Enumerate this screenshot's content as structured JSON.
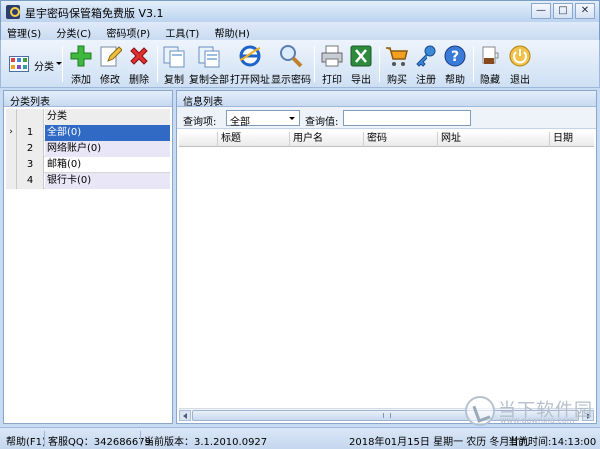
{
  "window": {
    "title": "星宇密码保管箱免费版 V3.1",
    "minimize": "—",
    "maximize": "□",
    "close": "✕"
  },
  "menu": [
    "管理(S)",
    "分类(C)",
    "密码项(P)",
    "工具(T)",
    "帮助(H)"
  ],
  "toolbar": {
    "category": "分类",
    "buttons": {
      "add": "添加",
      "edit": "修改",
      "delete": "删除",
      "copy": "复制",
      "copy_all": "复制全部",
      "open_url": "打开网址",
      "show_password": "显示密码",
      "print": "打印",
      "export": "导出",
      "buy": "购买",
      "register": "注册",
      "help": "帮助",
      "hide": "隐藏",
      "exit": "退出"
    }
  },
  "left_panel": {
    "title": "分类列表",
    "column_header": "分类",
    "rows": [
      {
        "num": "1",
        "name": "全部(0)",
        "indicator": "›"
      },
      {
        "num": "2",
        "name": "网络账户(0)",
        "indicator": ""
      },
      {
        "num": "3",
        "name": "邮箱(0)",
        "indicator": ""
      },
      {
        "num": "4",
        "name": "银行卡(0)",
        "indicator": ""
      }
    ]
  },
  "right_panel": {
    "title": "信息列表",
    "query_field_label": "查询项:",
    "query_field_value": "全部",
    "query_value_label": "查询值:",
    "query_value": "",
    "columns": [
      "标题",
      "用户名",
      "密码",
      "网址",
      "日期"
    ]
  },
  "status": {
    "help": "帮助(F1)",
    "qq": "客服QQ：342686679",
    "version": "当前版本：3.1.2010.0927",
    "date": "2018年01月15日 星期一 农历 冬月廿九",
    "time": "当前时间:14:13:00"
  },
  "watermark": {
    "text": "当下软件园",
    "url": "www.downxia.com"
  }
}
